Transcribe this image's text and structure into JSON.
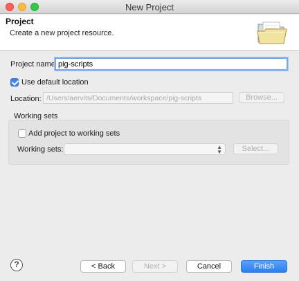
{
  "window": {
    "title": "New Project"
  },
  "banner": {
    "title": "Project",
    "description": "Create a new project resource.",
    "icon": "open-folder-icon"
  },
  "project_name": {
    "label": "Project name:",
    "value": "pig-scripts"
  },
  "use_default_location": {
    "label": "Use default location",
    "checked": true
  },
  "location": {
    "label": "Location:",
    "value": "/Users/aervits/Documents/workspace/pig-scripts",
    "browse_label": "Browse..."
  },
  "working_sets": {
    "section_label": "Working sets",
    "add_label": "Add project to working sets",
    "add_checked": false,
    "field_label": "Working sets:",
    "field_value": "",
    "select_label": "Select..."
  },
  "footer": {
    "help_label": "?",
    "back_label": "< Back",
    "next_label": "Next >",
    "cancel_label": "Cancel",
    "finish_label": "Finish"
  },
  "colors": {
    "accent": "#3b83f7",
    "focus_ring": "#7aa7e6",
    "primary_button": "#2a7ff0"
  }
}
